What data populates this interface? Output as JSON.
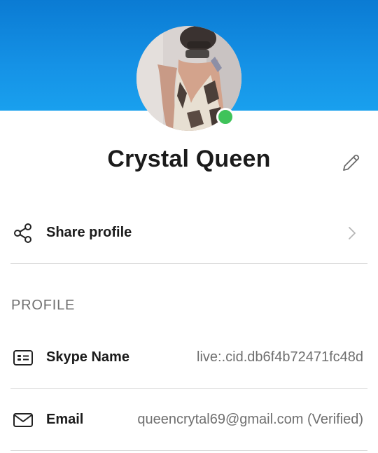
{
  "profile": {
    "display_name": "Crystal Queen",
    "presence": "online",
    "presence_color": "#3fc35a",
    "banner_color": "#0b7bd3"
  },
  "share": {
    "label": "Share profile",
    "icon": "share-icon"
  },
  "section": {
    "heading": "PROFILE"
  },
  "fields": {
    "skype_name": {
      "label": "Skype Name",
      "value": "live:.cid.db6f4b72471fc48d",
      "icon": "contact-card-icon"
    },
    "email": {
      "label": "Email",
      "value": "queencrytal69@gmail.com (Verified)",
      "icon": "mail-icon"
    }
  },
  "icons": {
    "edit": "pencil-icon",
    "chevron": "chevron-right-icon"
  }
}
